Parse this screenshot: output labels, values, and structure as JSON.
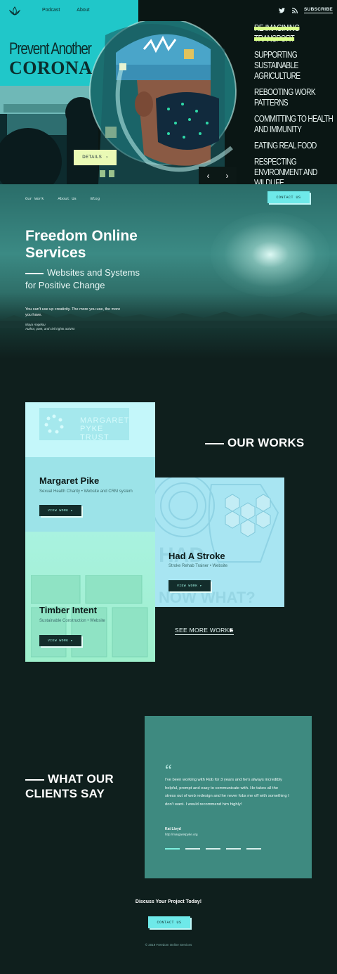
{
  "hero": {
    "nav": [
      {
        "label": "Podcast"
      },
      {
        "label": "About"
      }
    ],
    "title_line1": "Prevent Another",
    "title_line2": "CORONA",
    "details_label": "DETAILS",
    "subscribe_label": "SUBSCRIBE",
    "topics": [
      {
        "label": "Re-imagining Transport",
        "active": true
      },
      {
        "label": "Supporting Sustainable Agriculture",
        "active": false
      },
      {
        "label": "Rebooting Work Patterns",
        "active": false
      },
      {
        "label": "Committing to Health and Immunity",
        "active": false
      },
      {
        "label": "Eating Real Food",
        "active": false
      },
      {
        "label": "Respecting Environment and Wildlife",
        "active": false
      }
    ],
    "icons": [
      "twitter-icon",
      "rss-icon",
      "lotus-logo-icon",
      "chevron-left-icon",
      "chevron-right-icon"
    ]
  },
  "services": {
    "nav": [
      {
        "label": "Our Work"
      },
      {
        "label": "About Us"
      },
      {
        "label": "Blog"
      }
    ],
    "contact_label": "CONTACT US",
    "title": "Freedom Online Services",
    "subtitle_line1": "Websites and Systems",
    "subtitle_line2": "for Positive Change",
    "quote": "You can't use up creativity. The more you use, the more you have.",
    "quote_author": "Maya Angelou",
    "quote_author_desc": "Author, poet, and civil rights activist"
  },
  "works": {
    "title": "OUR WORKS",
    "see_more_label": "SEE MORE WORKS",
    "margaret_logo_text": "MARGARET PYKE TRUST",
    "projects": [
      {
        "name": "Margaret Pike",
        "meta": "Sexual Health Charity  •  Website and CRM system",
        "button": "VIEW WORK ▸"
      },
      {
        "name": "Had A Stroke",
        "meta": "Stroke Rehab Trainer  •  Website",
        "button": "VIEW WORK ▸"
      },
      {
        "name": "Timber Intent",
        "meta": "Sustainable Construction  •  Website",
        "button": "VIEW WORK ▸"
      }
    ]
  },
  "clients": {
    "title_line1": "WHAT OUR",
    "title_line2": "CLIENTS SAY",
    "quote_mark": "“",
    "testimonial": "I've been working with Rob for 3 years and he's always incredibly helpful, prompt and easy to communicate with. He takes all the stress out of web redesign and he never fobs me off with something I don't want. I would recommend him highly!",
    "name": "Kat Lloyd",
    "url": "http://margaretpyke.org",
    "dots": 5,
    "active_dot": 0
  },
  "footer": {
    "discuss": "Discuss Your Project Today!",
    "contact_label": "CONTACT US",
    "copyright": "© 2019 Freedom Online Services"
  },
  "colors": {
    "page_bg": "#0f1f1d",
    "accent_teal": "#20c7c9",
    "button_teal": "#6ee9e9",
    "card_teal": "#3e8a80",
    "highlight": "#d8ff8a"
  }
}
